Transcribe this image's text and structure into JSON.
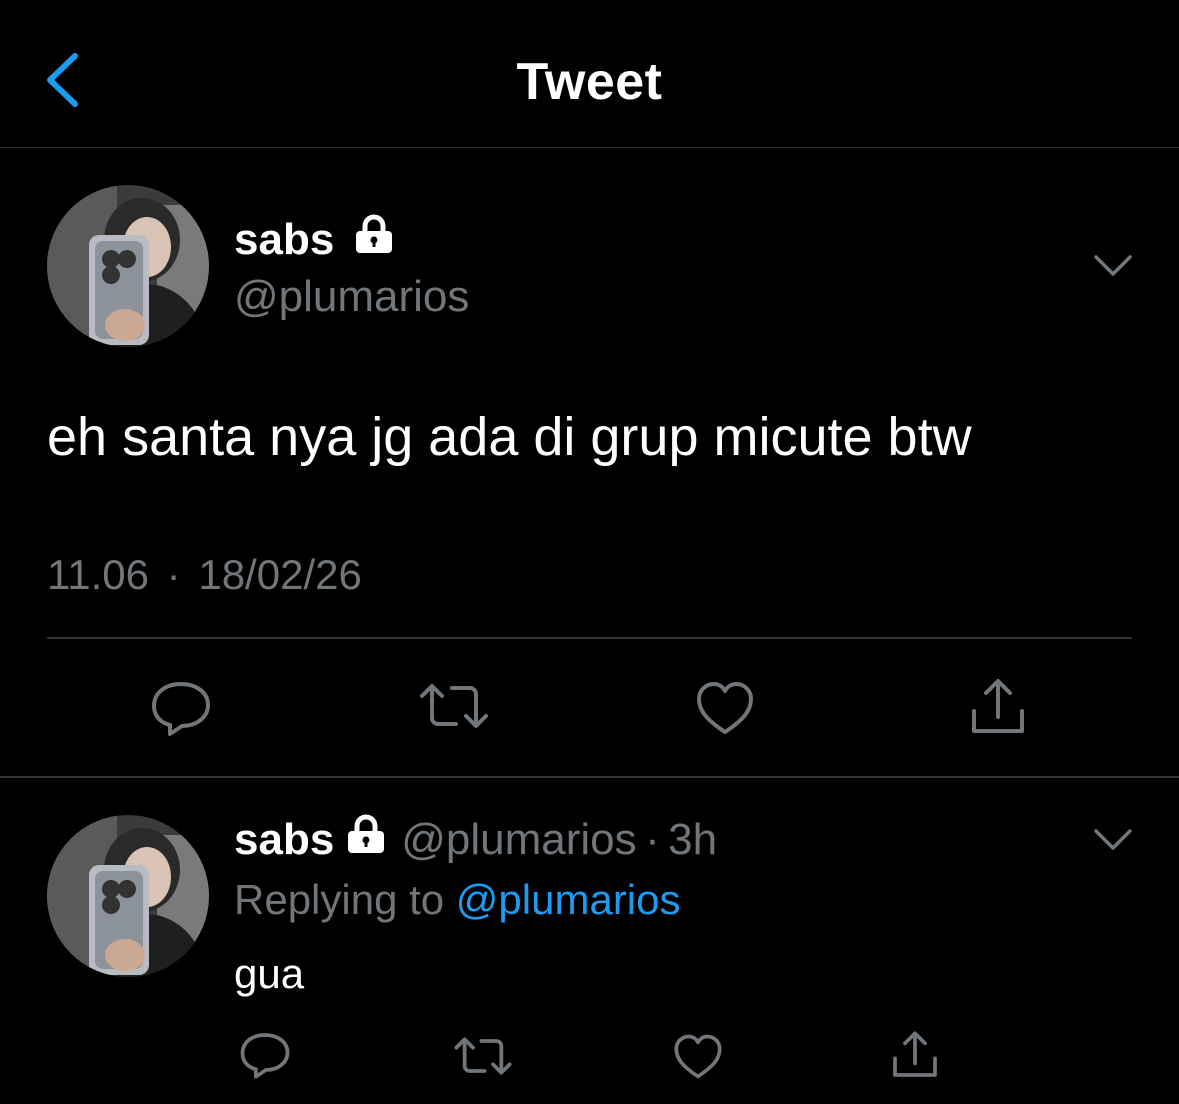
{
  "header": {
    "title": "Tweet",
    "back_icon": "chevron-left-icon",
    "accent_color": "#1d9bf0"
  },
  "main_tweet": {
    "author_name": "sabs",
    "author_handle": "@plumarios",
    "protected_icon": "lock-icon",
    "text": "eh santa nya jg ada di grup micute btw",
    "time": "11.06",
    "separator": "·",
    "date": "18/02/26",
    "actions": [
      "reply-icon",
      "retweet-icon",
      "like-icon",
      "share-icon"
    ]
  },
  "reply_tweet": {
    "author_name": "sabs",
    "author_handle": "@plumarios",
    "separator": "·",
    "age": "3h",
    "replying_prefix": "Replying to",
    "replying_to": "@plumarios",
    "text": "gua",
    "actions": [
      "reply-icon",
      "retweet-icon",
      "like-icon",
      "share-icon"
    ]
  }
}
